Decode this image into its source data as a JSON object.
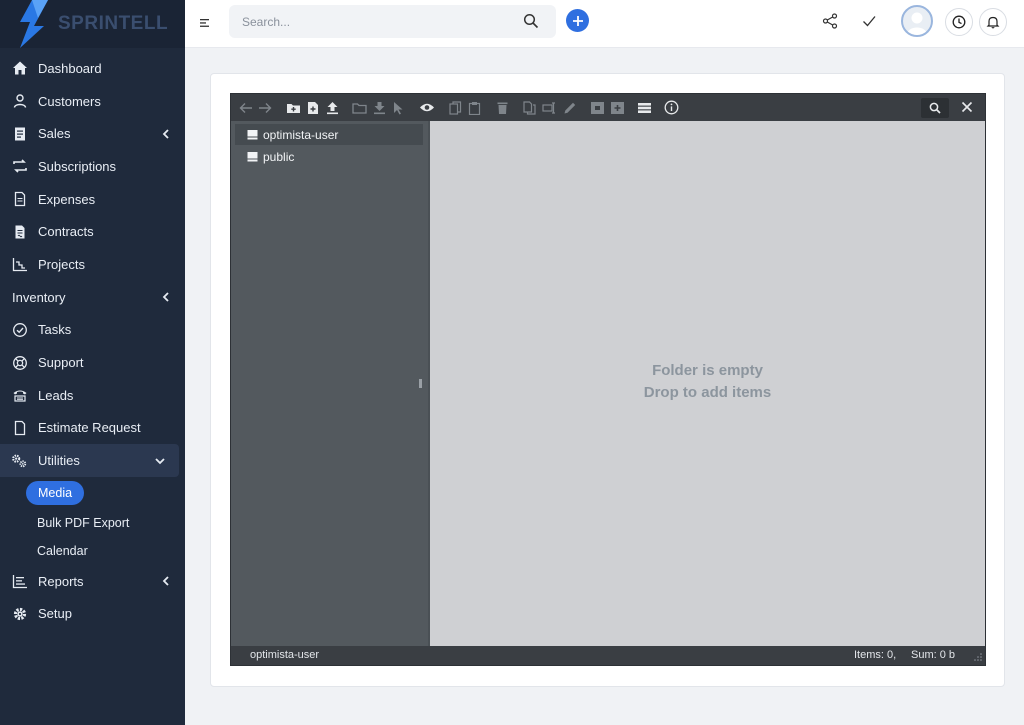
{
  "brand": {
    "name": "SPRINTELL"
  },
  "sidebar": {
    "items": [
      {
        "label": "Dashboard",
        "icon": "home-icon"
      },
      {
        "label": "Customers",
        "icon": "user-icon"
      },
      {
        "label": "Sales",
        "icon": "receipt-icon",
        "chevron": "left"
      },
      {
        "label": "Subscriptions",
        "icon": "repeat-icon"
      },
      {
        "label": "Expenses",
        "icon": "file-text-icon"
      },
      {
        "label": "Contracts",
        "icon": "contract-icon"
      },
      {
        "label": "Projects",
        "icon": "chart-icon"
      },
      {
        "label": "Inventory",
        "chevron": "left"
      },
      {
        "label": "Tasks",
        "icon": "check-circle-icon"
      },
      {
        "label": "Support",
        "icon": "lifebuoy-icon"
      },
      {
        "label": "Leads",
        "icon": "phone-icon"
      },
      {
        "label": "Estimate Request",
        "icon": "file-icon"
      },
      {
        "label": "Utilities",
        "icon": "cogs-icon",
        "chevron": "down"
      }
    ],
    "sub_items": [
      {
        "label": "Media",
        "selected": true
      },
      {
        "label": "Bulk PDF Export"
      },
      {
        "label": "Calendar"
      }
    ],
    "bottom_items": [
      {
        "label": "Reports",
        "icon": "bar-list-icon",
        "chevron": "left"
      },
      {
        "label": "Setup",
        "icon": "gear-icon"
      }
    ]
  },
  "header": {
    "search_placeholder": "Search...",
    "accent": "#2f6fe0"
  },
  "file_manager": {
    "tree": [
      {
        "label": "optimista-user",
        "selected": true
      },
      {
        "label": "public"
      }
    ],
    "empty_line1": "Folder is empty",
    "empty_line2": "Drop to add items",
    "status": {
      "path": "optimista-user",
      "items": "Items: 0,",
      "sum": "Sum: 0 b"
    }
  }
}
